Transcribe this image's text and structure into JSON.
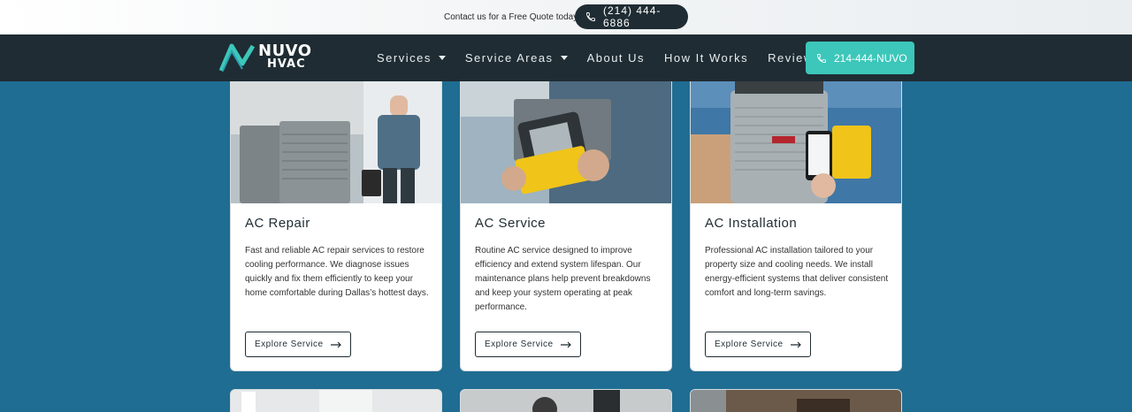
{
  "topbar": {
    "contact_text": "Contact us for a Free Quote today",
    "phone": "(214) 444-6886"
  },
  "nav": {
    "logo_line1": "NUVO",
    "logo_line2": "HVAC",
    "menu": [
      {
        "label": "Services",
        "dropdown": true
      },
      {
        "label": "Service Areas",
        "dropdown": true
      },
      {
        "label": "About Us",
        "dropdown": false
      },
      {
        "label": "How It Works",
        "dropdown": false
      },
      {
        "label": "Reviews",
        "dropdown": false
      }
    ],
    "cta_label": "214-444-NUVO"
  },
  "cards": [
    {
      "title": "AC Repair",
      "description": "Fast and reliable AC repair services to restore cooling performance. We diagnose issues quickly and fix them efficiently to keep your home comfortable during Dallas’s hottest days.",
      "button": "Explore Service"
    },
    {
      "title": "AC Service",
      "description": "Routine AC service designed to improve efficiency and extend system lifespan. Our maintenance plans help prevent breakdowns and keep your system operating at peak performance.",
      "button": "Explore Service"
    },
    {
      "title": "AC Installation",
      "description": "Professional AC installation tailored to your property size and cooling needs. We install energy-efficient systems that deliver consistent comfort and long-term savings.",
      "button": "Explore Service"
    }
  ],
  "colors": {
    "page_bg": "#1f6d92",
    "nav_bg": "#1f2c33",
    "cta_bg": "#3cc7ba",
    "logo_accent": "#3cc7ba"
  }
}
